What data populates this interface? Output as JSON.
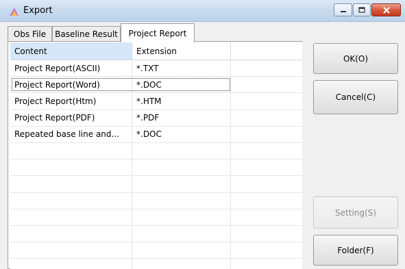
{
  "window": {
    "title": "Export"
  },
  "tabs": [
    {
      "label": "Obs File"
    },
    {
      "label": "Baseline Result"
    },
    {
      "label": "Project Report"
    }
  ],
  "table": {
    "columns": [
      "Content",
      "Extension"
    ],
    "rows": [
      {
        "content": "Project Report(ASCII)",
        "extension": "*.TXT"
      },
      {
        "content": "Project Report(Word)",
        "extension": "*.DOC"
      },
      {
        "content": "Project Report(Htm)",
        "extension": "*.HTM"
      },
      {
        "content": "Project Report(PDF)",
        "extension": "*.PDF"
      },
      {
        "content": "Repeated base line and...",
        "extension": "*.DOC"
      }
    ]
  },
  "buttons": {
    "ok": "OK(O)",
    "cancel": "Cancel(C)",
    "setting": "Setting(S)",
    "folder": "Folder(F)"
  },
  "colors": {
    "titlebar": "#c9dcef",
    "header_selected": "#d6e8f8",
    "close_button": "#d7573a"
  }
}
